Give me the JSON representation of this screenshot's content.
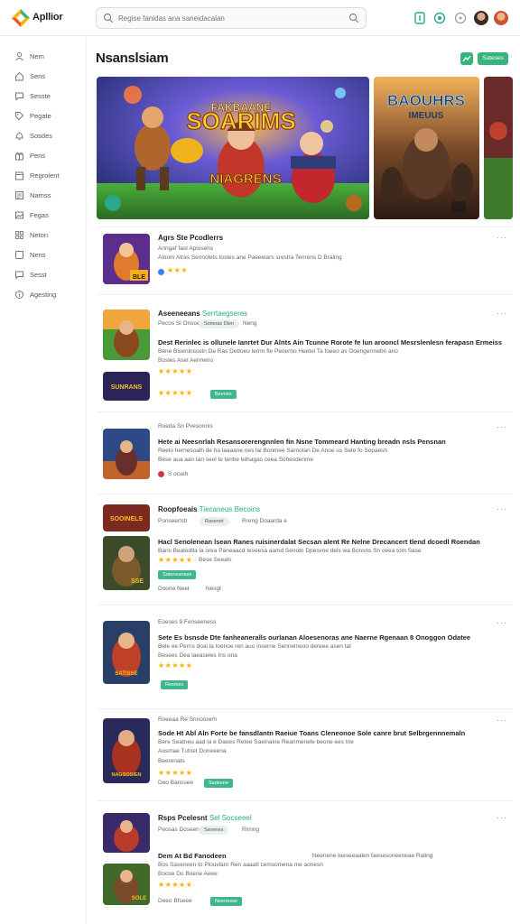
{
  "header": {
    "brand": "Apllior",
    "search_placeholder": "Regise fanidas ana saneidacalan",
    "avatars": [
      "avatar-1",
      "avatar-2"
    ]
  },
  "sidebar": {
    "items": [
      {
        "label": "Nem",
        "icon": "user-icon"
      },
      {
        "label": "Sens",
        "icon": "home-icon"
      },
      {
        "label": "Sesste",
        "icon": "chat-icon"
      },
      {
        "label": "Pegate",
        "icon": "tag-icon"
      },
      {
        "label": "Sosdes",
        "icon": "bell-icon"
      },
      {
        "label": "Pens",
        "icon": "gift-icon"
      },
      {
        "label": "Regrolent",
        "icon": "calendar-icon"
      },
      {
        "label": "Namss",
        "icon": "list-icon"
      },
      {
        "label": "Fegas",
        "icon": "image-icon"
      },
      {
        "label": "Neton",
        "icon": "grid-icon"
      },
      {
        "label": "Nens",
        "icon": "box-icon"
      },
      {
        "label": "Sesst",
        "icon": "chat-icon"
      },
      {
        "label": "Agesting",
        "icon": "info-icon"
      }
    ]
  },
  "main": {
    "title": "Nsanslsiam",
    "button_label": "Sateses"
  },
  "banners": [
    {
      "title": "SOARIMS",
      "subtitle": "FAKBAANE",
      "footer": "NIAGRENS",
      "accent": "#f6c21c"
    },
    {
      "title": "BAOUHRS",
      "subtitle": "IMEUUS",
      "footer": "",
      "accent": "#5ec0e6"
    }
  ],
  "feed": [
    {
      "title": "Agrs Ste Pcodlerrs",
      "accent": "",
      "meta": "Anngaf fast Aplosens",
      "sub": "Aloom Atras Sennolets tostes ane Paeeelars srestra Tenrens D Braling",
      "stars": "★★★",
      "thumb_label": "BLE"
    },
    {
      "title": "Aseeneeans",
      "accent": "Serrtaegseres",
      "meta": "Pecos Sl Onsoee",
      "pill": "Somoas Dlen",
      "meta2": "Neng",
      "head": "Dest Rerinlec is ollunele Ianrtet Dur Alnts Ain Tcunne Rorote fe lun arooncl Mesrslenlesn ferapasn Ermeiss",
      "body": "Bene Bloeninsceln De Ras Dettoeu lerrm fle Peoerno Heetel Ta foeeo as Ooengerrnebn ano",
      "body2": "Bosles Asel Aennerio",
      "stars": "★★★★★",
      "stars2": "★★★★★",
      "tag": "Beenes",
      "thumb_label": "",
      "thumb2_label": "SUNRANS"
    },
    {
      "title": "Roeda Sn Pvesonnis",
      "meta": "",
      "head": "Hete ai Neesnrlah Resansorerengnnlen fin Nsne Tommeard Hanting breadn nsls Pensnan",
      "body": "Reelo hernesoalh de ha laaaane nes lal Bonmee Sarnotan De Anoe us Sete fo Sopaesh",
      "body2": "Bese aua aan tan seel te tenhe lelhagas ceea Sohesdenme",
      "foot": "S orseh",
      "thumb_label": ""
    },
    {
      "title": "Roopfoeais",
      "accent": "Tiecaneus Becoins",
      "meta": "Ponseerlstl",
      "pill": "Rasenot",
      "meta2": "Rreng  Doaarda e",
      "head": "Hacl Senolenean lsean Ranes ruisinerdalat Secsan alent Re Nelne Drecancert tlend dcoedl Roendan",
      "body": "Bans Beatedlla la orea Paneaacd Ieseesa aamd Senotn Dpesvoe dels wa Bonsns Sn oeea tom Sase",
      "stars": "★★★★★",
      "stars_note": "Bese Seeals",
      "tag": "Sateneanase",
      "foot": "Doone Neel",
      "foot2": "Nesgt",
      "thumb_label": "SOOINELS",
      "thumb2_label": "SSE"
    },
    {
      "title": "Eoeses 9 Fenseeness",
      "head": "Sete Es bsnsde Dte fanheaneralls ourlanan Aloesenoras ane Naerne Rgenaan 8 Onoggon Odatee",
      "body": "Bele ee Perns doal la Ioenoe ren auo inserne Sennelneoo dereee asen tat",
      "body2": "Besees Dea laeaseles Ins ona",
      "stars": "★★★★★",
      "tag": "Resmes",
      "thumb_label": "SATISSE"
    },
    {
      "title": "Roeeaa Re Snnoorerh",
      "head": "Sode Ht Abl Aln Forte be fansdlantn Raeiue Toans Cleneonoe Sole canre brut Selbrgennnemaln",
      "body": "Bere Seatneu aad la e Daoes Retee Saeinaine Reanmenele beone ees tne",
      "body2": "Aosmae Tutnet Doneeena",
      "foot_small": "Beerenats",
      "stars": "★★★★★",
      "foot": "Deo Banssee",
      "tag": "Sadeene",
      "thumb_label": "NAGSOSIEN"
    },
    {
      "title": "Rsps Pcelesnt",
      "accent": "Sel Socseeel",
      "meta": "Peosas Doseens",
      "pill": "Ssoenes",
      "meta2": "Rirnng",
      "head": "Dem At Bd Fanodeen",
      "head_right": "Neenene loeseeaalen faesesoneeneae Raling",
      "body": "Bos Saseneen to Plouvlarn Ren aaaatl cemsomena me aonesn",
      "body2": "Boose Do Boene Aeee",
      "stars": "★★★★★",
      "foot": "Deeo Bfseee",
      "tag": "Neeneese",
      "thumb_label": "",
      "thumb2_label": "SOLE"
    }
  ],
  "colors": {
    "accent": "#36b37e",
    "teal": "#2aa889",
    "star": "#f5b301"
  }
}
